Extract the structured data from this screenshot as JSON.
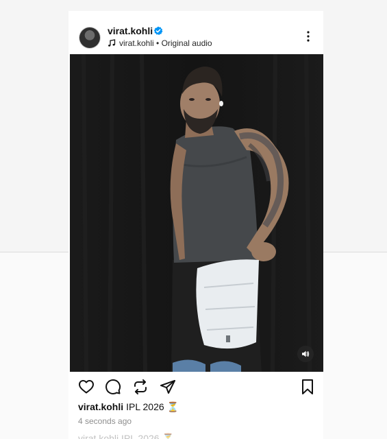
{
  "post": {
    "username": "virat.kohli",
    "audio_owner": "virat.kohli",
    "audio_separator": " • ",
    "audio_title": "Original audio",
    "caption_user": "virat.kohli",
    "caption_text": "IPL 2026 ⏳",
    "timestamp": "4 seconds ago"
  },
  "next_post": {
    "caption": "virat.kohli IPL 2026 ⏳"
  },
  "icons": {
    "verified": "verified-badge-icon",
    "music": "music-note-icon",
    "more": "more-vertical-icon",
    "mute": "speaker-icon",
    "like": "heart-icon",
    "comment": "comment-icon",
    "repost": "repost-icon",
    "share": "send-icon",
    "save": "bookmark-icon"
  },
  "colors": {
    "verified_blue": "#0095f6",
    "text_primary": "#111111",
    "text_secondary": "#8e8e8e",
    "media_background": "#141414"
  }
}
